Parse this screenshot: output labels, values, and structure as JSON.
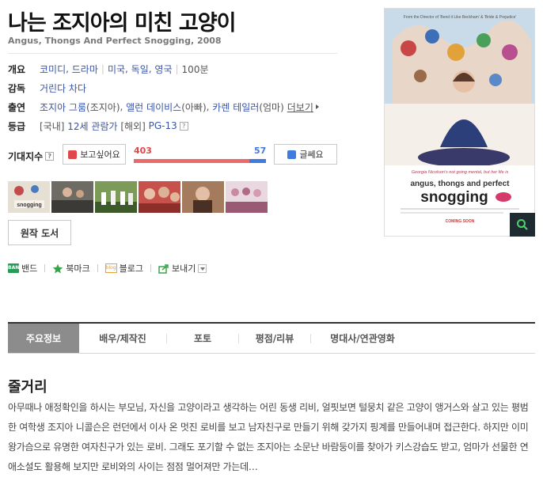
{
  "movie": {
    "title": "나는 조지아의 미친 고양이",
    "subtitle": "Angus, Thongs And Perfect Snogging, 2008"
  },
  "info": {
    "overview": {
      "label": "개요",
      "genres": [
        "코미디",
        "드라마"
      ],
      "countries": [
        "미국",
        "독일",
        "영국"
      ],
      "runtime": "100분"
    },
    "director": {
      "label": "감독",
      "name": "거린다 차다"
    },
    "cast": {
      "label": "출연",
      "members": [
        {
          "name": "조지아 그룸",
          "role": "(조지아)"
        },
        {
          "name": "앨런 데이비스",
          "role": "(아빠)"
        },
        {
          "name": "카렌 테일러",
          "role": "(엄마)"
        }
      ],
      "more_label": "더보기"
    },
    "rating": {
      "label": "등급",
      "domestic_prefix": "[국내]",
      "domestic": "12세 관람가",
      "overseas_prefix": "[해외]",
      "overseas": "PG-13",
      "help": "?"
    }
  },
  "expectation": {
    "label": "기대지수",
    "help": "?",
    "like_label": "보고싶어요",
    "dislike_label": "글쎄요",
    "likes": "403",
    "dislikes": "57",
    "like_ratio": 0.876
  },
  "stills": [
    {
      "name": "still-poster",
      "color": "#d8cfc3"
    },
    {
      "name": "still-1",
      "color": "#5c5a55"
    },
    {
      "name": "still-2",
      "color": "#4f6a3c"
    },
    {
      "name": "still-3",
      "color": "#b7453f"
    },
    {
      "name": "still-4",
      "color": "#6b4a37"
    },
    {
      "name": "still-5",
      "color": "#c77f96"
    }
  ],
  "source_button": "원작 도서",
  "share": {
    "band_icon_text": "BAND",
    "band": "밴드",
    "bookmark": "북마크",
    "blog_icon_text": "blog",
    "blog": "블로그",
    "send": "보내기"
  },
  "poster": {
    "tagline_top": "From the Director of 'Bend it Like Beckham' & 'Bride & Prejudice'",
    "tagline": "Georgia Nicolson's not going mental, but her life is",
    "title_line1": "angus, thongs and perfect",
    "title_line2": "snogging",
    "coming_soon": "COMING SOON"
  },
  "tabs": [
    "주요정보",
    "배우/제작진",
    "포토",
    "평점/리뷰",
    "명대사/연관영화"
  ],
  "synopsis": {
    "heading": "줄거리",
    "text": "아무때나 애정확인을 하시는 부모님, 자신을 고양이라고 생각하는 어린 동생 리비, 얼핏보면 털뭉치 같은 고양이 앵거스와 살고 있는 평범한 여학생 조지아 니콜슨은 런던에서 이사 온 멋진 로비를 보고 남자친구로 만들기 위해 갖가지 핑계를 만들어내며 접근한다. 하지만 이미 왕가슴으로 유명한 여자친구가 있는 로비. 그래도 포기할 수 없는 조지아는 소문난 바람둥이를 찾아가 키스강습도 받고, 엄마가 선물한 연애소설도 활용해 보지만 로비와의 사이는 점점 멀어져만 가는데…"
  },
  "colors": {
    "link": "#3a55a8",
    "like": "#e0474c",
    "dislike": "#3f7ae0",
    "active_tab": "#8c8c8c",
    "zoom_button": "#1e2b30"
  }
}
